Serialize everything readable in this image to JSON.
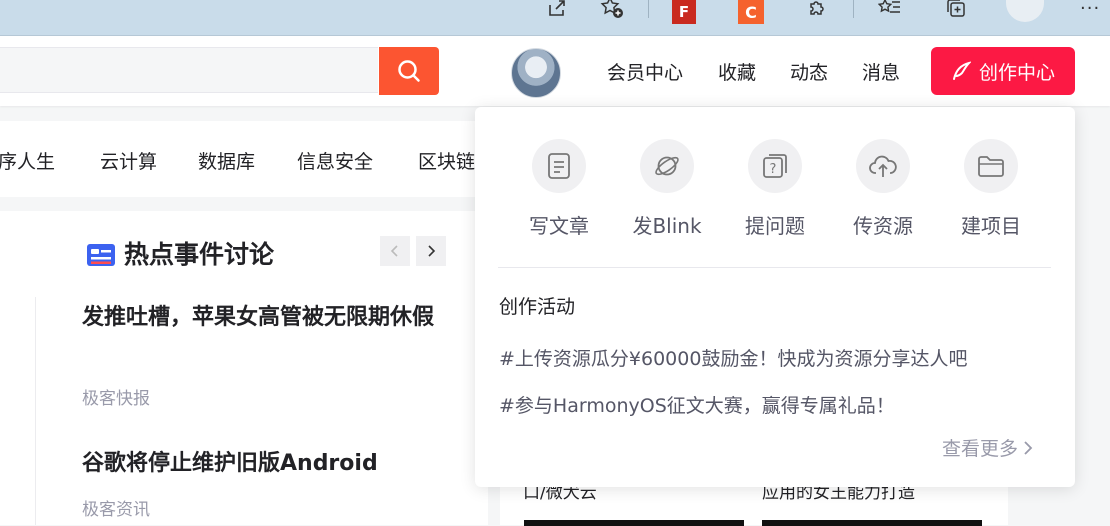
{
  "header": {
    "search": {
      "placeholder": ""
    },
    "nav": [
      {
        "label": "会员中心"
      },
      {
        "label": "收藏"
      },
      {
        "label": "动态"
      },
      {
        "label": "消息"
      }
    ],
    "create_label": "创作中心"
  },
  "browser_toolbar": {
    "ext_flash_label": "F",
    "ext_c_label": "C"
  },
  "categories": [
    "序人生",
    "云计算",
    "数据库",
    "信息安全",
    "区块链"
  ],
  "hot_topics": {
    "title": "热点事件讨论",
    "articles": [
      {
        "title": "发推吐槽，苹果女高管被无限期休假",
        "source": "极客快报"
      },
      {
        "title": "谷歌将停止维护旧版Android",
        "source": "极客资讯"
      }
    ]
  },
  "right_cards": {
    "left_text": "口/微犬云",
    "right_text": "应用的女王能力打造"
  },
  "dropdown": {
    "quick_actions": [
      {
        "label": "写文章",
        "icon": "document-icon"
      },
      {
        "label": "发Blink",
        "icon": "planet-icon"
      },
      {
        "label": "提问题",
        "icon": "question-icon"
      },
      {
        "label": "传资源",
        "icon": "cloud-upload-icon"
      },
      {
        "label": "建项目",
        "icon": "folder-icon"
      }
    ],
    "activity_heading": "创作活动",
    "activities": [
      "#上传资源瓜分¥60000鼓励金！快成为资源分享达人吧",
      "#参与HarmonyOS征文大赛，赢得专属礼品！"
    ],
    "more_label": "查看更多"
  },
  "colors": {
    "accent": "#fc1944",
    "search": "#fc5531",
    "muted": "#999aaa"
  }
}
